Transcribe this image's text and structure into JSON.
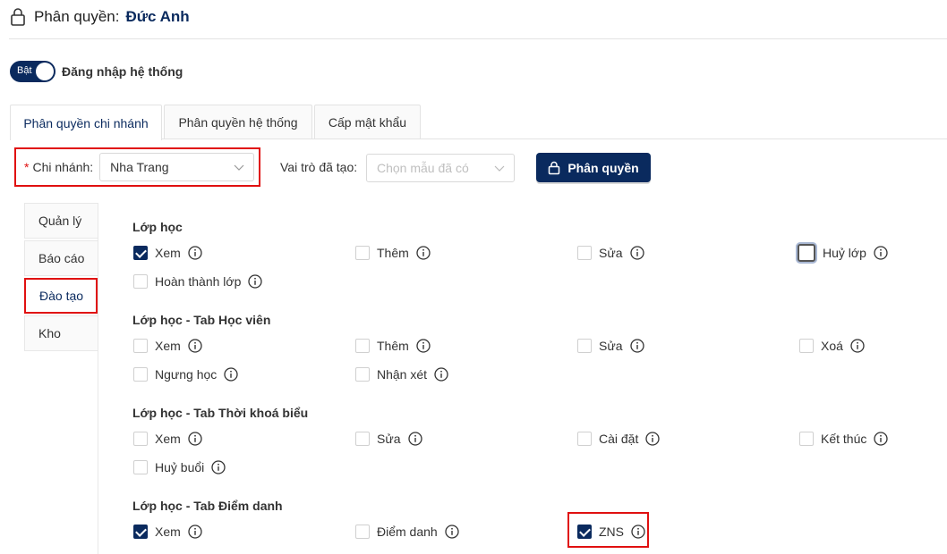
{
  "header": {
    "title_prefix": "Phân quyền:",
    "user_name": "Đức Anh"
  },
  "toggle": {
    "state_label": "Bật",
    "label": "Đăng nhập hệ thống"
  },
  "tabs": [
    {
      "label": "Phân quyền chi nhánh"
    },
    {
      "label": "Phân quyền hệ thống"
    },
    {
      "label": "Cấp mật khẩu"
    }
  ],
  "filters": {
    "required_mark": "*",
    "branch_label": "Chi nhánh",
    "branch_colon": ":",
    "branch_value": "Nha Trang",
    "role_label": "Vai trò đã tạo:",
    "role_placeholder": "Chọn mẫu đã có",
    "assign_button": "Phân quyền"
  },
  "sidebar": {
    "items": [
      {
        "label": "Quản lý"
      },
      {
        "label": "Báo cáo"
      },
      {
        "label": "Đào tạo"
      },
      {
        "label": "Kho"
      }
    ]
  },
  "sections": [
    {
      "title": "Lớp học",
      "options": [
        {
          "label": "Xem",
          "checked": true
        },
        {
          "label": "Thêm",
          "checked": false
        },
        {
          "label": "Sửa",
          "checked": false
        },
        {
          "label": "Huỷ lớp",
          "checked": false
        },
        {
          "label": "Hoàn thành lớp",
          "checked": false
        }
      ]
    },
    {
      "title": "Lớp học - Tab Học viên",
      "options": [
        {
          "label": "Xem",
          "checked": false
        },
        {
          "label": "Thêm",
          "checked": false
        },
        {
          "label": "Sửa",
          "checked": false
        },
        {
          "label": "Xoá",
          "checked": false
        },
        {
          "label": "Ngưng học",
          "checked": false
        },
        {
          "label": "Nhận xét",
          "checked": false
        }
      ]
    },
    {
      "title": "Lớp học - Tab Thời khoá biểu",
      "options": [
        {
          "label": "Xem",
          "checked": false
        },
        {
          "label": "Sửa",
          "checked": false
        },
        {
          "label": "Cài đặt",
          "checked": false
        },
        {
          "label": "Kết thúc",
          "checked": false
        },
        {
          "label": "Huỷ buổi",
          "checked": false
        }
      ]
    },
    {
      "title": "Lớp học - Tab Điểm danh",
      "options": [
        {
          "label": "Xem",
          "checked": true
        },
        {
          "label": "Điểm danh",
          "checked": false
        },
        {
          "label": "ZNS",
          "checked": true
        }
      ]
    }
  ],
  "colors": {
    "primary": "#0a2a5e",
    "highlight": "#e01010",
    "border": "#d9d9d9"
  },
  "icons": {
    "title": "lock-icon",
    "button": "lock-icon",
    "option": "info-circle-icon",
    "select": "chevron-down-icon"
  }
}
